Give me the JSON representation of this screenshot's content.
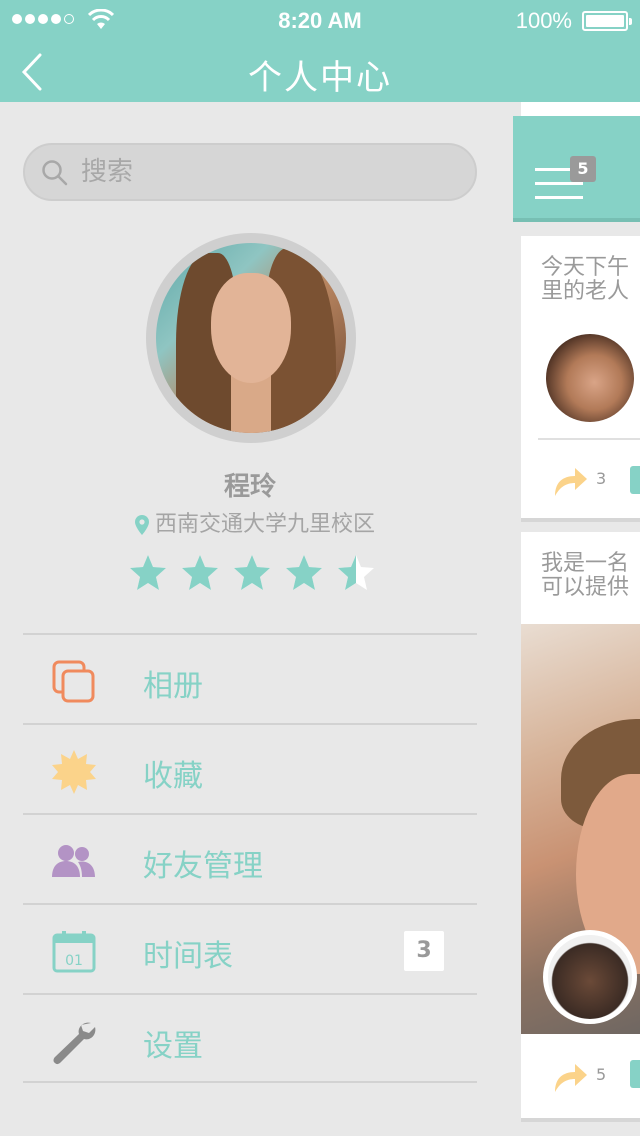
{
  "status_bar": {
    "time": "8:20 AM",
    "battery": "100%"
  },
  "nav": {
    "title": "个人中心",
    "back_icon": "chevron-left-icon"
  },
  "search": {
    "placeholder": "搜索",
    "icon": "search-icon"
  },
  "profile": {
    "name": "程玲",
    "location": "西南交通大学九里校区",
    "rating": 4.5,
    "rating_max": 5
  },
  "menu": {
    "items": [
      {
        "label": "相册",
        "icon": "album-icon",
        "color": "#f08a5d"
      },
      {
        "label": "收藏",
        "icon": "favorites-sun-icon",
        "color": "#fbd38a"
      },
      {
        "label": "好友管理",
        "icon": "friends-icon",
        "color": "#b393c5"
      },
      {
        "label": "时间表",
        "icon": "calendar-icon",
        "color": "#86d2c6",
        "badge": "3",
        "calendar_day": "01"
      },
      {
        "label": "设置",
        "icon": "wrench-icon",
        "color": "#8a8a8a"
      }
    ]
  },
  "feed": {
    "menu_badge": "5",
    "cards": [
      {
        "text_line1": "今天下午",
        "text_line2": "里的老人",
        "share_count": "3"
      },
      {
        "text_line1": "我是一名",
        "text_line2": "可以提供",
        "share_count": "5"
      }
    ]
  },
  "colors": {
    "accent": "#86d2c6",
    "background": "#e8e8e8",
    "text_muted": "#9a9a9a"
  }
}
